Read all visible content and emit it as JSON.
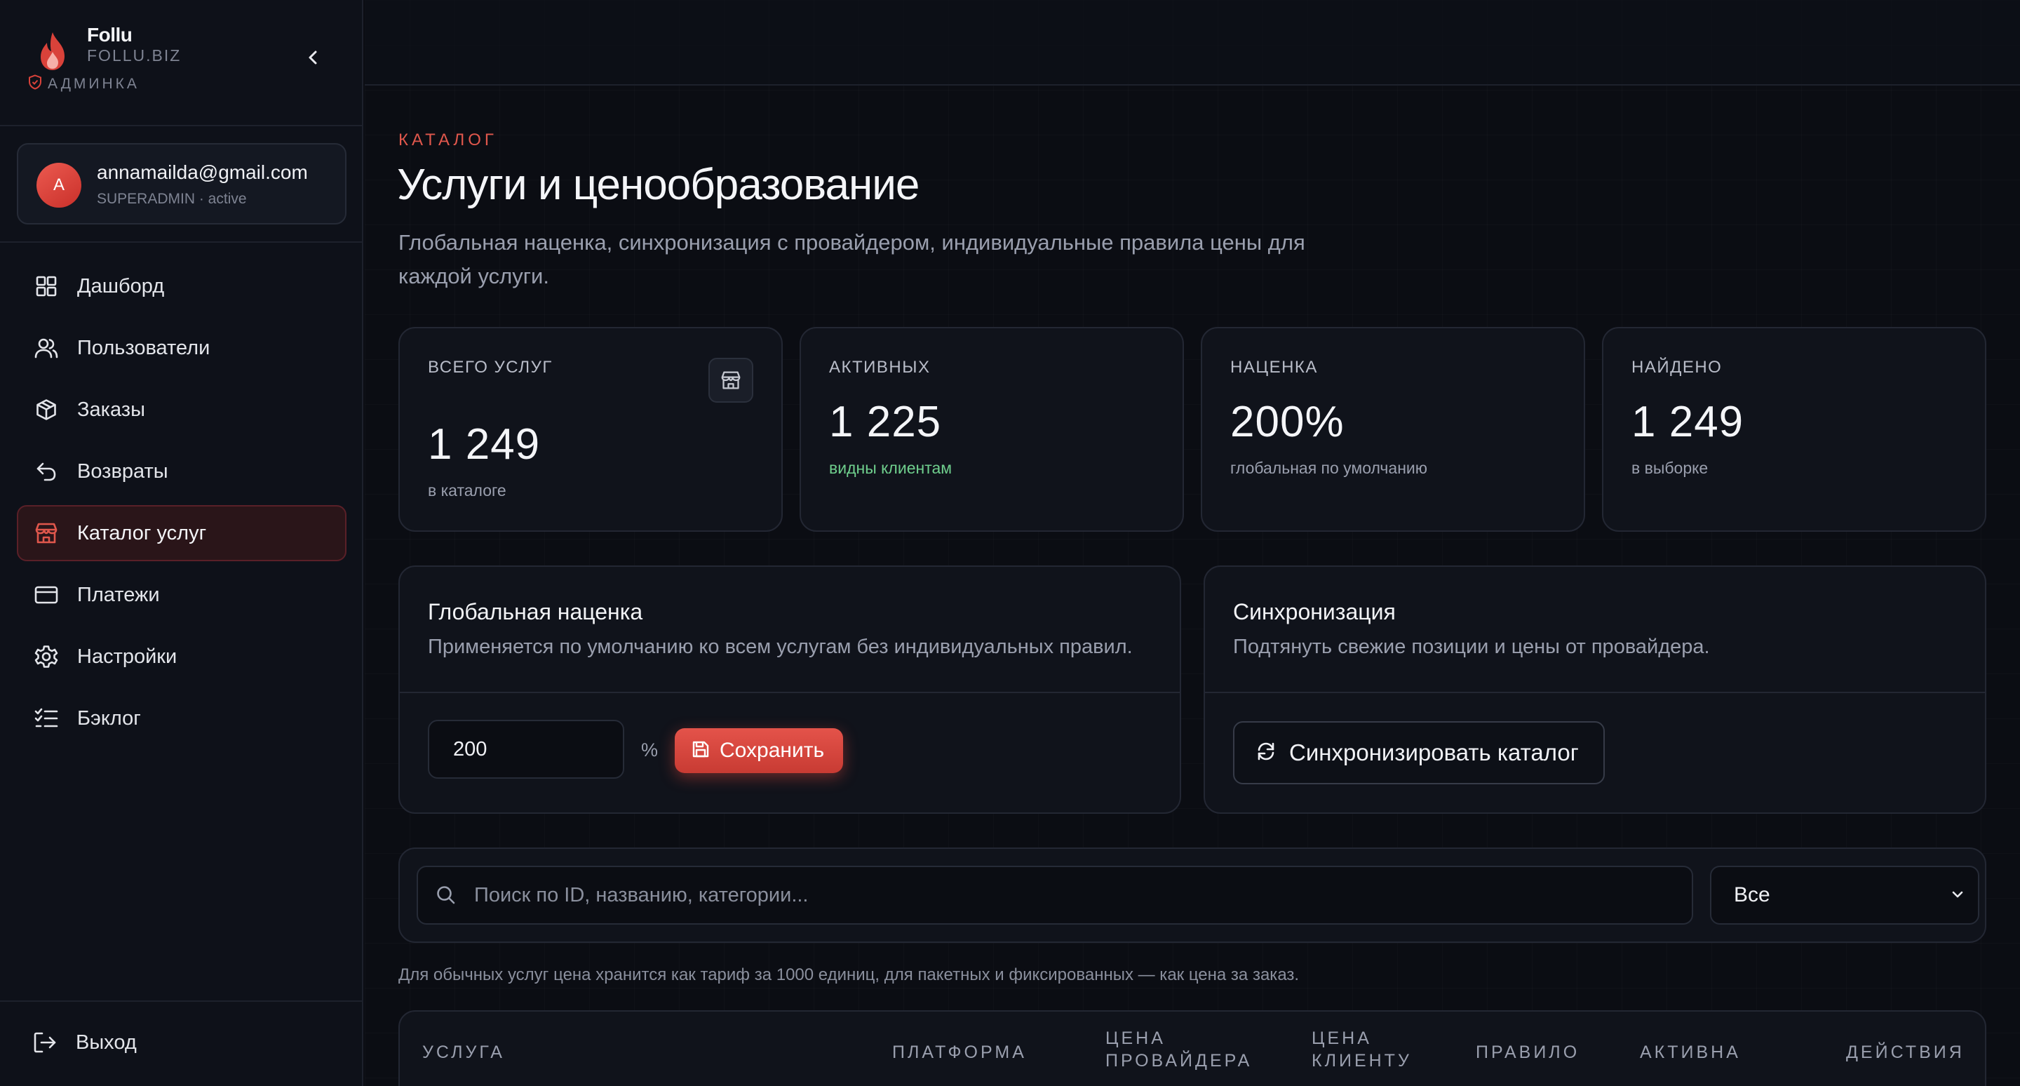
{
  "brand": {
    "name": "Follu",
    "domain": "FOLLU.BIZ",
    "badge": "АДМИНКА"
  },
  "user": {
    "avatar_letter": "A",
    "email": "annamailda@gmail.com",
    "role": "SUPERADMIN · active"
  },
  "nav": {
    "items": [
      {
        "label": "Дашборд",
        "icon": "dashboard-icon"
      },
      {
        "label": "Пользователи",
        "icon": "users-icon"
      },
      {
        "label": "Заказы",
        "icon": "box-icon"
      },
      {
        "label": "Возвраты",
        "icon": "undo-icon"
      },
      {
        "label": "Каталог услуг",
        "icon": "store-icon",
        "active": true
      },
      {
        "label": "Платежи",
        "icon": "credit-card-icon"
      },
      {
        "label": "Настройки",
        "icon": "gear-icon"
      },
      {
        "label": "Бэклог",
        "icon": "checklist-icon"
      }
    ],
    "logout": "Выход"
  },
  "page": {
    "eyebrow": "КАТАЛОГ",
    "title": "Услуги и ценообразование",
    "subtitle": "Глобальная наценка, синхронизация с провайдером, индивидуальные правила цены для каждой услуги."
  },
  "stats": [
    {
      "label": "ВСЕГО УСЛУГ",
      "value": "1 249",
      "sub": "в каталоге"
    },
    {
      "label": "АКТИВНЫХ",
      "value": "1 225",
      "sub": "видны клиентам"
    },
    {
      "label": "НАЦЕНКА",
      "value": "200%",
      "sub": "глобальная по умолчанию"
    },
    {
      "label": "НАЙДЕНО",
      "value": "1 249",
      "sub": "в выборке"
    }
  ],
  "markup_panel": {
    "title": "Глобальная наценка",
    "description": "Применяется по умолчанию ко всем услугам без индивидуальных правил.",
    "value": "200",
    "unit": "%",
    "save_label": "Сохранить"
  },
  "sync_panel": {
    "title": "Синхронизация",
    "description": "Подтянуть свежие позиции и цены от провайдера.",
    "button_label": "Синхронизировать каталог"
  },
  "filter": {
    "search_placeholder": "Поиск по ID, названию, категории...",
    "select_value": "Все"
  },
  "note": "Для обычных услуг цена хранится как тариф за 1000 единиц, для пакетных и фиксированных — как цена за заказ.",
  "table": {
    "headers": [
      "УСЛУГА",
      "ПЛАТФОРМА",
      "ЦЕНА ПРОВАЙДЕРА",
      "ЦЕНА КЛИЕНТУ",
      "ПРАВИЛО",
      "АКТИВНА",
      "ДЕЙСТВИЯ"
    ]
  },
  "colors": {
    "accent": "#e0574c",
    "success": "#6fcf8d",
    "background": "#0b0d13"
  }
}
